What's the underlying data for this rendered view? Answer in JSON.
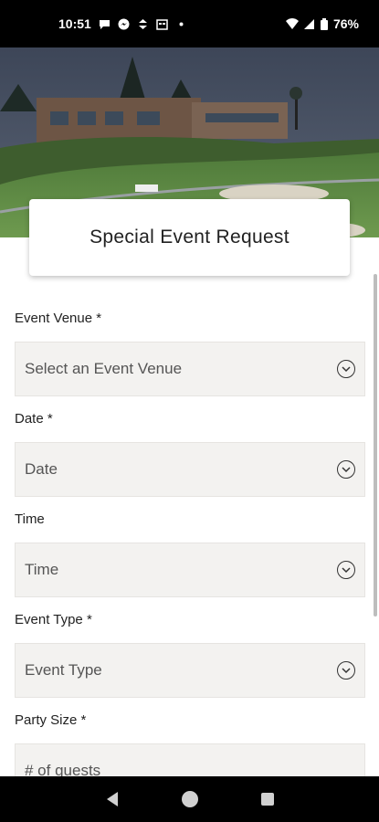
{
  "status": {
    "time": "10:51",
    "battery": "76%"
  },
  "title": "Special Event Request",
  "fields": [
    {
      "label": "Event Venue *",
      "placeholder": "Select an Event Venue"
    },
    {
      "label": "Date *",
      "placeholder": "Date"
    },
    {
      "label": "Time",
      "placeholder": "Time"
    },
    {
      "label": "Event Type *",
      "placeholder": "Event Type"
    },
    {
      "label": "Party Size *",
      "placeholder": "# of guests"
    }
  ],
  "colors": {
    "field_bg": "#f3f2f0",
    "status_bg": "#000000"
  }
}
